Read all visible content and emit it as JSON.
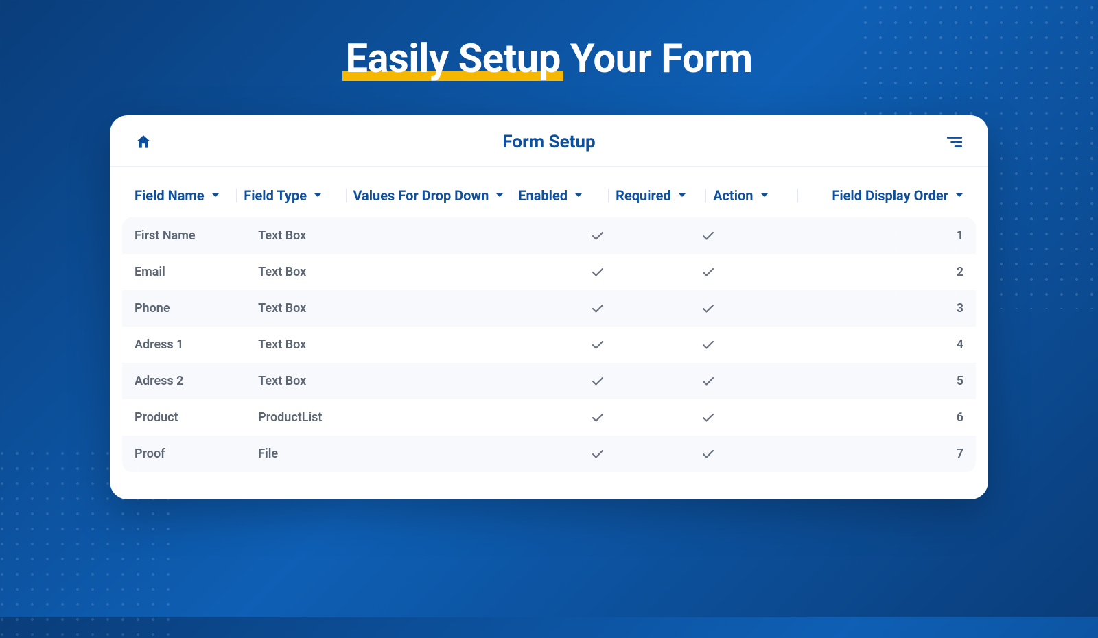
{
  "hero": {
    "highlight": "Easily Setup",
    "rest": " Your Form"
  },
  "card": {
    "title": "Form Setup"
  },
  "table": {
    "headers": {
      "name": "Field Name",
      "type": "Field Type",
      "values": "Values For Drop Down",
      "enabled": "Enabled",
      "required": "Required",
      "action": "Action",
      "order": "Field Display Order"
    },
    "rows": [
      {
        "name": "First Name",
        "type": "Text Box",
        "values": "",
        "enabled": true,
        "required": true,
        "action": "",
        "order": "1"
      },
      {
        "name": "Email",
        "type": "Text Box",
        "values": "",
        "enabled": true,
        "required": true,
        "action": "",
        "order": "2"
      },
      {
        "name": "Phone",
        "type": "Text Box",
        "values": "",
        "enabled": true,
        "required": true,
        "action": "",
        "order": "3"
      },
      {
        "name": "Adress 1",
        "type": "Text Box",
        "values": "",
        "enabled": true,
        "required": true,
        "action": "",
        "order": "4"
      },
      {
        "name": "Adress 2",
        "type": "Text Box",
        "values": "",
        "enabled": true,
        "required": true,
        "action": "",
        "order": "5"
      },
      {
        "name": "Product",
        "type": "ProductList",
        "values": "",
        "enabled": true,
        "required": true,
        "action": "",
        "order": "6"
      },
      {
        "name": "Proof",
        "type": "File",
        "values": "",
        "enabled": true,
        "required": true,
        "action": "",
        "order": "7"
      }
    ]
  }
}
